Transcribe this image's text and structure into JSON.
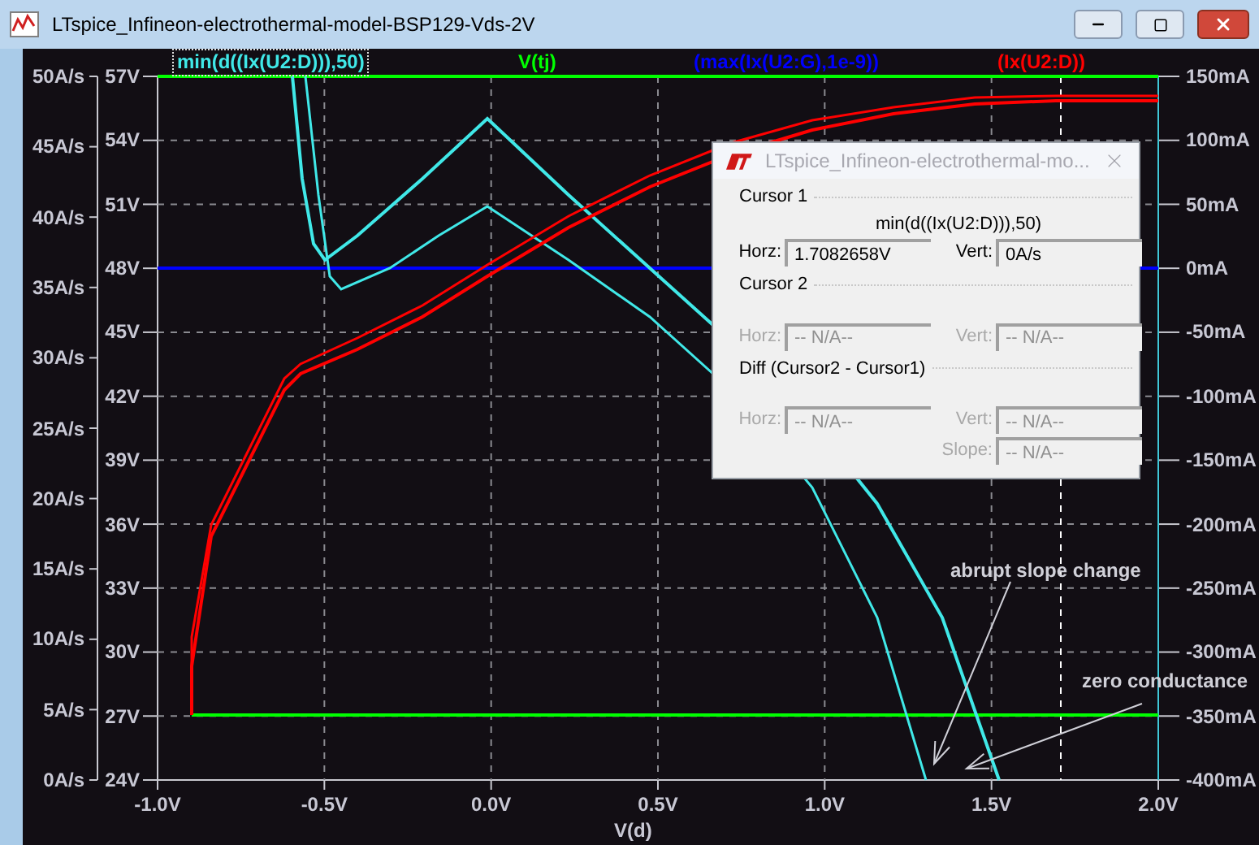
{
  "window": {
    "title": "LTspice_Infineon-electrothermal-model-BSP129-Vds-2V"
  },
  "legend": [
    {
      "label": "min(d((Ix(U2:D))),50)",
      "color": "#40e8e8",
      "selected": true
    },
    {
      "label": "V(tj)",
      "color": "#00ff00",
      "selected": false
    },
    {
      "label": "(max(Ix(U2:G),1e-9))",
      "color": "#0000ff",
      "selected": false
    },
    {
      "label": "(Ix(U2:D))",
      "color": "#ff0000",
      "selected": false
    }
  ],
  "axes": {
    "left_outer": {
      "ticks": [
        "50A/s",
        "45A/s",
        "40A/s",
        "35A/s",
        "30A/s",
        "25A/s",
        "20A/s",
        "15A/s",
        "10A/s",
        "5A/s",
        "0A/s"
      ]
    },
    "left_inner": {
      "ticks": [
        "57V",
        "54V",
        "51V",
        "48V",
        "45V",
        "42V",
        "39V",
        "36V",
        "33V",
        "30V",
        "27V",
        "24V"
      ]
    },
    "right": {
      "ticks": [
        "150mA",
        "100mA",
        "50mA",
        "0mA",
        "-50mA",
        "-100mA",
        "-150mA",
        "-200mA",
        "-250mA",
        "-300mA",
        "-350mA",
        "-400mA"
      ]
    },
    "bottom": {
      "ticks": [
        "-1.0V",
        "-0.5V",
        "0.0V",
        "0.5V",
        "1.0V",
        "1.5V",
        "2.0V"
      ],
      "label": "V(d)"
    }
  },
  "annotations": [
    {
      "text": "abrupt slope change"
    },
    {
      "text": "zero conductance"
    }
  ],
  "cursor_dialog": {
    "title": "LTspice_Infineon-electrothermal-mo...",
    "sections": [
      {
        "title": "Cursor 1",
        "trace": "min(d((Ix(U2:D))),50)",
        "disabled": false,
        "fields": [
          {
            "label": "Horz:",
            "value": "1.7082658V"
          },
          {
            "label": "Vert:",
            "value": "0A/s"
          }
        ]
      },
      {
        "title": "Cursor 2",
        "disabled": true,
        "fields": [
          {
            "label": "Horz:",
            "value": "-- N/A--"
          },
          {
            "label": "Vert:",
            "value": "-- N/A--"
          }
        ]
      },
      {
        "title": "Diff (Cursor2 - Cursor1)",
        "disabled": true,
        "fields": [
          {
            "label": "Horz:",
            "value": "-- N/A--"
          },
          {
            "label": "Vert:",
            "value": "-- N/A--"
          },
          {
            "label": "Slope:",
            "value": "-- N/A--"
          }
        ]
      }
    ]
  }
}
